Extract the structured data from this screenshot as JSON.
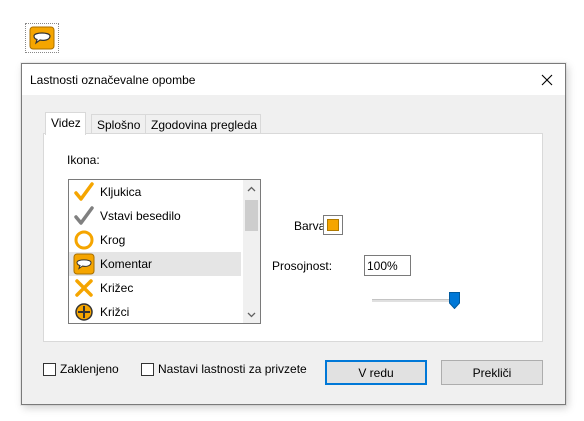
{
  "dialog": {
    "title": "Lastnosti označevalne opombe",
    "close_glyph": "✕"
  },
  "tabs": [
    {
      "label": "Videz",
      "active": true
    },
    {
      "label": "Splošno",
      "active": false
    },
    {
      "label": "Zgodovina pregleda",
      "active": false
    }
  ],
  "appearance": {
    "icon_label": "Ikona:",
    "icon_list": [
      {
        "label": "Kljukica",
        "icon": "checkmark-orange-icon",
        "selected": false
      },
      {
        "label": "Vstavi besedilo",
        "icon": "checkmark-gray-icon",
        "selected": false
      },
      {
        "label": "Krog",
        "icon": "circle-icon",
        "selected": false
      },
      {
        "label": "Komentar",
        "icon": "comment-icon",
        "selected": true
      },
      {
        "label": "Križec",
        "icon": "cross-icon",
        "selected": false
      },
      {
        "label": "Križci",
        "icon": "crosshairs-icon",
        "selected": false
      }
    ],
    "color_label": "Barva:",
    "color_value": "#f5a500",
    "opacity_label": "Prosojnost:",
    "opacity_value": "100%",
    "opacity_fraction": 1.0
  },
  "footer": {
    "locked_label": "Zaklenjeno",
    "locked_checked": false,
    "set_default_label": "Nastavi lastnosti za privzete",
    "set_default_checked": false,
    "ok_label": "V redu",
    "cancel_label": "Prekliči"
  },
  "colors": {
    "accent": "#0078d7",
    "icon_orange": "#f5a500",
    "icon_gray": "#808080"
  }
}
